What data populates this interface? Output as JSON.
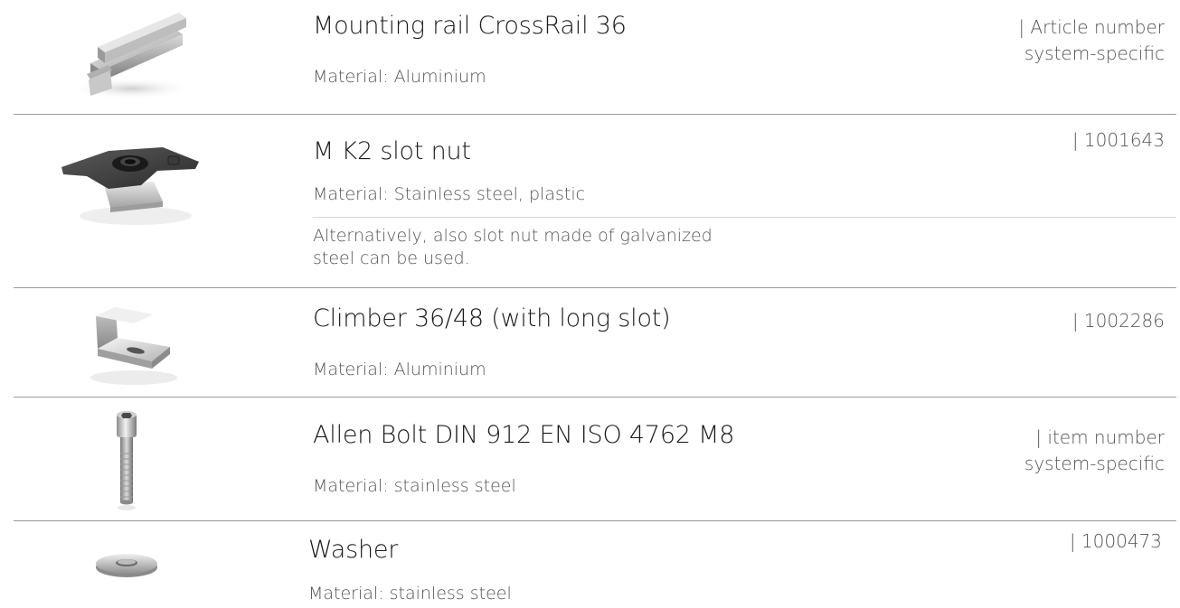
{
  "items": [
    {
      "title": "Mounting rail CrossRail 36",
      "material": "Material: Aluminium",
      "article_line1": "| Article number",
      "article_line2": "system-specific",
      "icon": "mounting-rail-icon"
    },
    {
      "title": "M K2 slot nut",
      "material": "Material: Stainless steel, plastic",
      "note_line1": "Alternatively, also slot nut made of galvanized",
      "note_line2": "steel can be used.",
      "article_line1": "| 1001643",
      "icon": "slot-nut-icon"
    },
    {
      "title": "Climber 36/48 (with long slot)",
      "material": "Material: Aluminium",
      "article_line1": "| 1002286",
      "icon": "climber-icon"
    },
    {
      "title": "Allen Bolt DIN 912 EN ISO 4762 M8",
      "material": "Material: stainless steel",
      "article_line1": "| item number",
      "article_line2": "system-specific",
      "icon": "allen-bolt-icon"
    },
    {
      "title": "Washer",
      "material": "Material: stainless steel",
      "article_line1": "| 1000473",
      "icon": "washer-icon"
    }
  ]
}
